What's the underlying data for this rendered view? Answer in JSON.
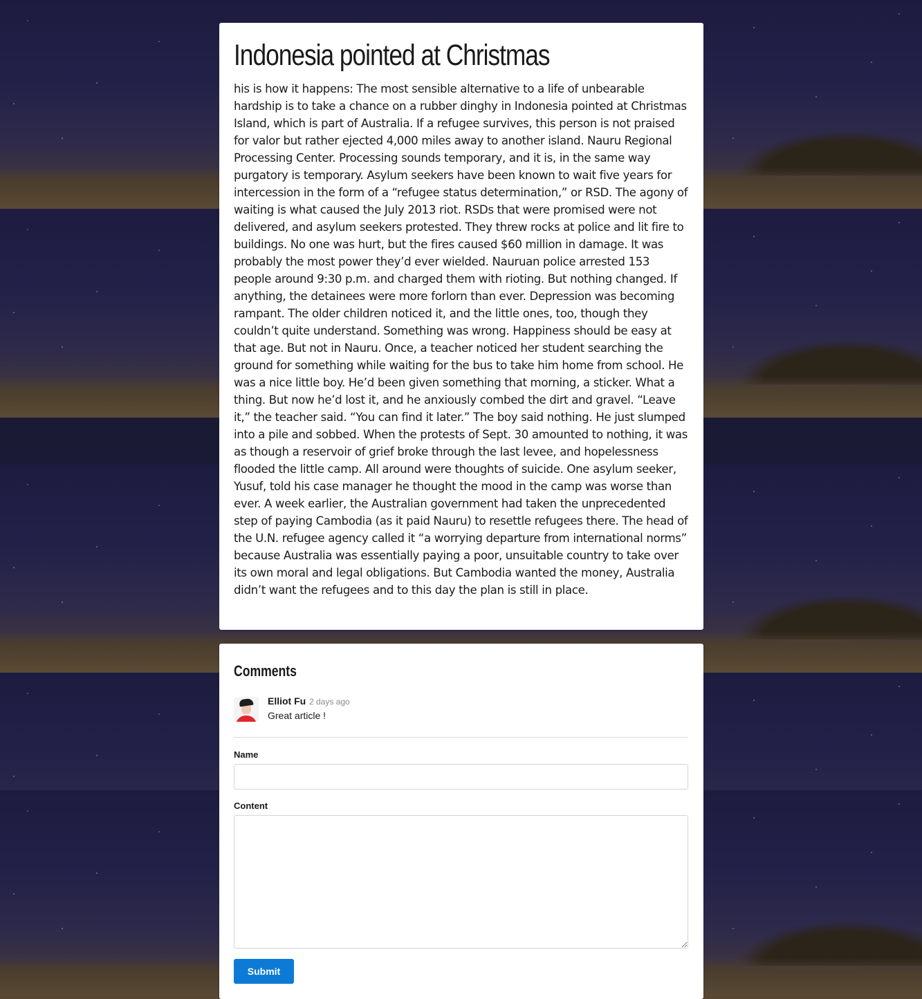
{
  "article": {
    "title": "Indonesia pointed at Christmas",
    "body": "his is how it happens: The most sensible alternative to a life of unbearable hardship is to take a chance on a rubber dinghy in Indonesia pointed at Christmas Island, which is part of Australia. If a refugee survives, this person is not praised for valor but rather ejected 4,000 miles away to another island. Nauru Regional Processing Center. Processing sounds temporary, and it is, in the same way purgatory is temporary. Asylum seekers have been known to wait five years for intercession in the form of a “refugee status determination,” or RSD. The agony of waiting is what caused the July 2013 riot. RSDs that were promised were not delivered, and asylum seekers protested. They threw rocks at police and lit fire to buildings. No one was hurt, but the fires caused $60 million in damage. It was probably the most power they’d ever wielded. Nauruan police arrested 153 people around 9:30 p.m. and charged them with rioting. But nothing changed. If anything, the detainees were more forlorn than ever. Depression was becoming rampant. The older children noticed it, and the little ones, too, though they couldn’t quite understand. Something was wrong. Happiness should be easy at that age. But not in Nauru. Once, a teacher noticed her student searching the ground for something while waiting for the bus to take him home from school. He was a nice little boy. He’d been given something that morning, a sticker. What a thing. But now he’d lost it, and he anxiously combed the dirt and gravel. “Leave it,” the teacher said. “You can find it later.” The boy said nothing. He just slumped into a pile and sobbed. When the protests of Sept. 30 amounted to nothing, it was as though a reservoir of grief broke through the last levee, and hopelessness flooded the little camp. All around were thoughts of suicide. One asylum seeker, Yusuf, told his case manager he thought the mood in the camp was worse than ever. A week earlier, the Australian government had taken the unprecedented step of paying Cambodia (as it paid Nauru) to resettle refugees there. The head of the U.N. refugee agency called it “a worrying departure from international norms” because Australia was essentially paying a poor, unsuitable country to take over its own moral and legal obligations. But Cambodia wanted the money, Australia didn’t want the refugees and to this day the plan is still in place."
  },
  "comments": {
    "title": "Comments",
    "items": [
      {
        "author": "Elliot Fu",
        "date": "2 days ago",
        "text": "Great article !",
        "avatar_icon": "user-avatar-icon"
      }
    ]
  },
  "form": {
    "name_label": "Name",
    "name_value": "",
    "content_label": "Content",
    "content_value": "",
    "submit_label": "Submit"
  },
  "colors": {
    "submit_button": "#0d7bd5",
    "card_background": "#ffffff"
  }
}
